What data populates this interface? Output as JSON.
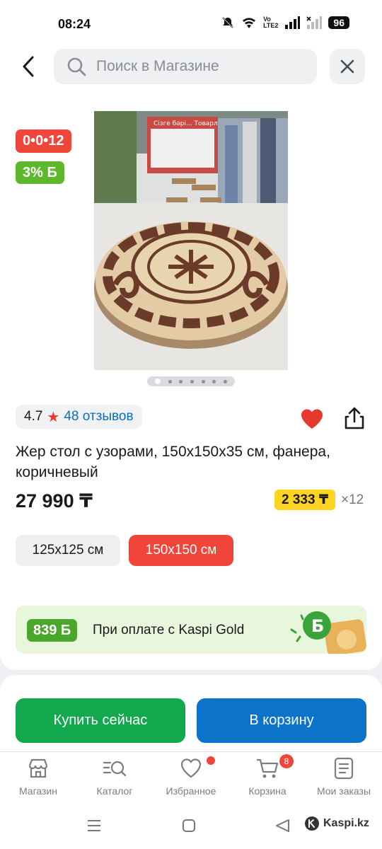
{
  "status_bar": {
    "time": "08:24",
    "net_label_top": "Vo",
    "net_label_bottom": "LTE2",
    "battery": "96"
  },
  "header": {
    "search_placeholder": "Поиск в Магазине"
  },
  "product": {
    "installment_badge": "0•0•12",
    "bonus_badge": "3% Б",
    "image_page_count": 7,
    "image_page_current": 1,
    "rating": "4.7",
    "reviews": "48 отзывов",
    "title": "Жер стол с узорами, 150х150х35 см, фанера, коричневый",
    "price": "27 990 ₸",
    "monthly_payment": "2 333 ₸",
    "months": "×12",
    "image_sign": "Сізге бәрі... Товарлар"
  },
  "sizes": [
    {
      "label": "125х125 см",
      "selected": false
    },
    {
      "label": "150х150 см",
      "selected": true
    }
  ],
  "promo": {
    "bonus": "839 Б",
    "text": "При оплате с Kaspi Gold"
  },
  "actions": {
    "buy_now": "Купить сейчас",
    "add_to_cart": "В корзину"
  },
  "bottom_nav": {
    "items": [
      {
        "label": "Магазин",
        "icon": "store-icon"
      },
      {
        "label": "Каталог",
        "icon": "catalog-search-icon"
      },
      {
        "label": "Избранное",
        "icon": "heart-outline-icon"
      },
      {
        "label": "Корзина",
        "icon": "cart-icon"
      },
      {
        "label": "Мои заказы",
        "icon": "orders-list-icon"
      }
    ],
    "cart_count": "8"
  },
  "watermark": "Kaspi.kz",
  "colors": {
    "accent_red": "#f0463a",
    "bonus_green": "#5eb82b",
    "buy_green": "#11a84e",
    "cart_blue": "#0b73c9",
    "monthly_yellow": "#ffd322",
    "link_blue": "#0a6fc2"
  }
}
